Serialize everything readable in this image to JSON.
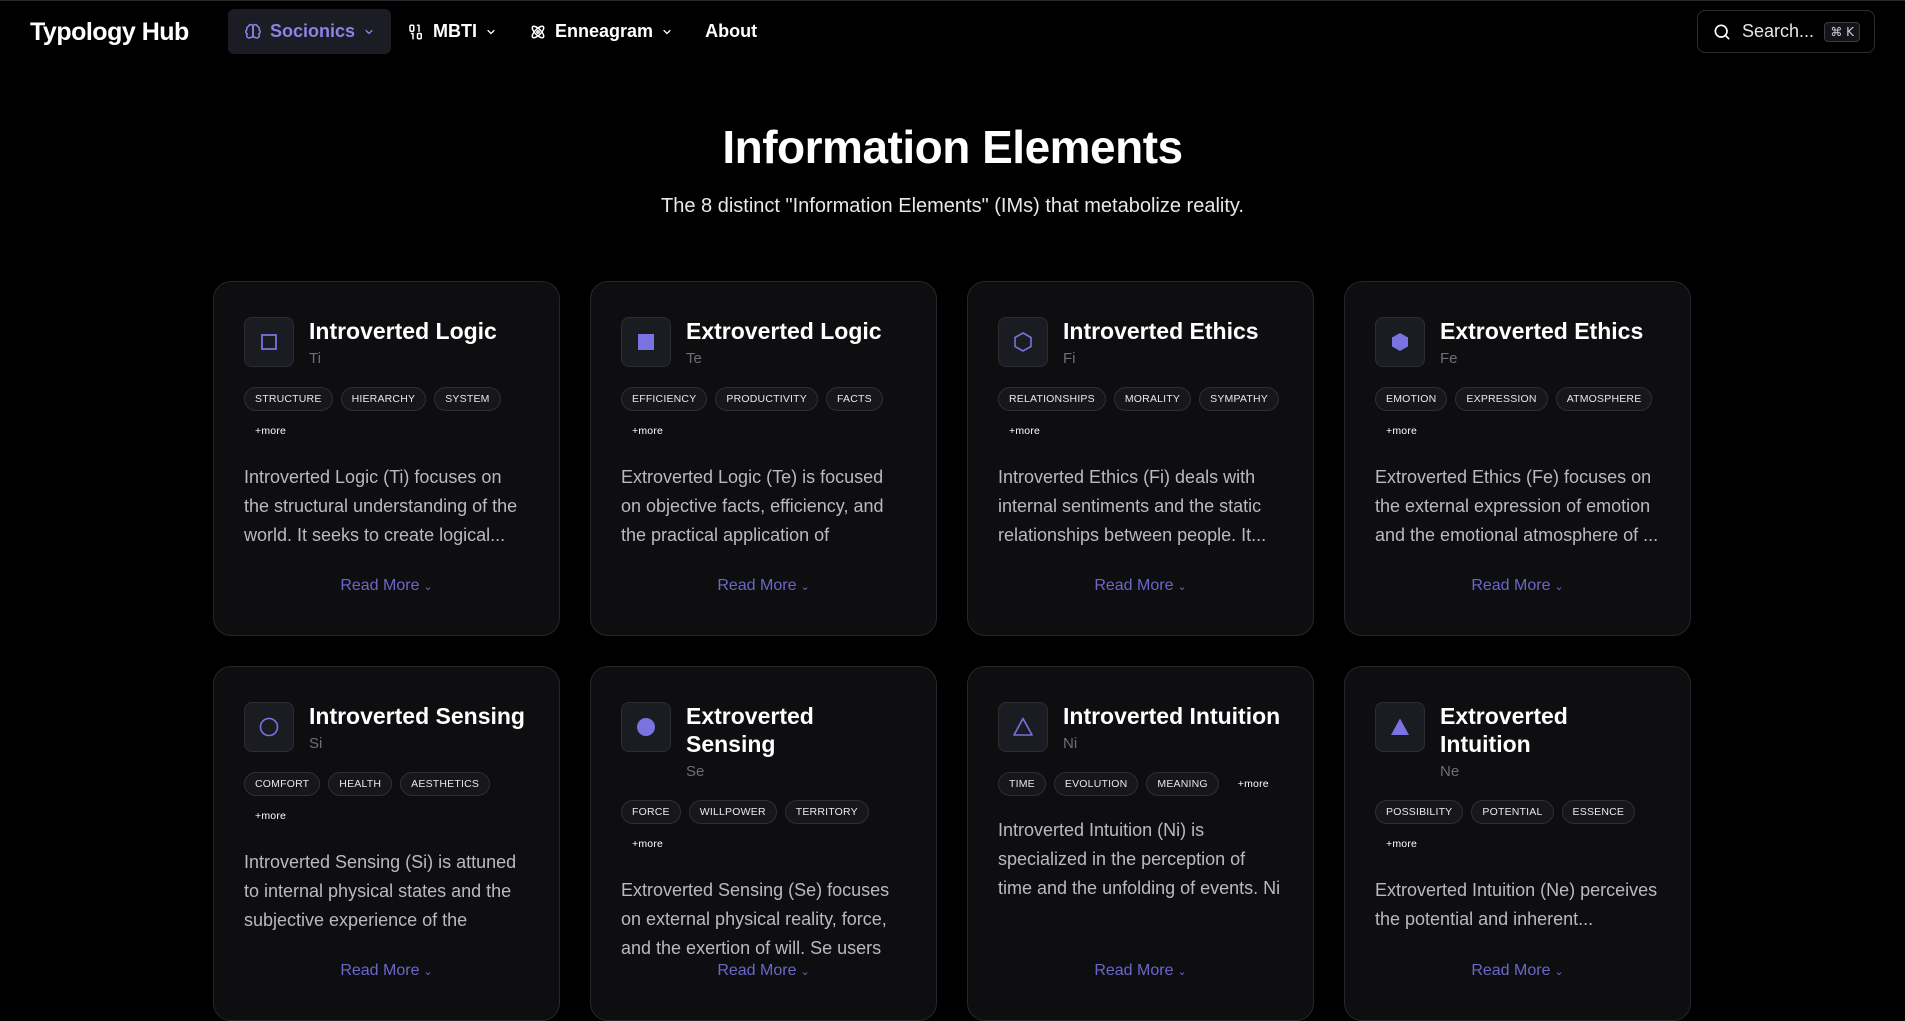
{
  "brand": "Typology Hub",
  "nav": [
    {
      "label": "Socionics",
      "icon": "brain-icon",
      "dropdown": true,
      "active": true
    },
    {
      "label": "MBTI",
      "icon": "binary-icon",
      "dropdown": true,
      "active": false
    },
    {
      "label": "Enneagram",
      "icon": "atom-icon",
      "dropdown": true,
      "active": false
    },
    {
      "label": "About",
      "icon": "",
      "dropdown": false,
      "active": false
    }
  ],
  "search": {
    "placeholder": "Search...",
    "shortcut": "⌘ K"
  },
  "hero": {
    "title": "Information Elements",
    "subtitle": "The 8 distinct \"Information Elements\" (IMs) that metabolize reality."
  },
  "colors": {
    "accent": "#6d66c9",
    "icon_fill": "#7a72e0"
  },
  "cards": [
    {
      "title": "Introverted Logic",
      "abbr": "Ti",
      "icon": "square-outline-icon",
      "tags": [
        "STRUCTURE",
        "HIERARCHY",
        "SYSTEM"
      ],
      "more": "+more",
      "description": "Introverted Logic (Ti) focuses on the structural understanding of the world. It seeks to create logical...",
      "read_more": "Read More"
    },
    {
      "title": "Extroverted Logic",
      "abbr": "Te",
      "icon": "square-filled-icon",
      "tags": [
        "EFFICIENCY",
        "PRODUCTIVITY",
        "FACTS"
      ],
      "more": "+more",
      "description": "Extroverted Logic (Te) is focused on objective facts, efficiency, and the practical application of knowledge....",
      "read_more": "Read More"
    },
    {
      "title": "Introverted Ethics",
      "abbr": "Fi",
      "icon": "hexagon-outline-icon",
      "tags": [
        "RELATIONSHIPS",
        "MORALITY",
        "SYMPATHY"
      ],
      "more": "+more",
      "description": "Introverted Ethics (Fi) deals with internal sentiments and the static relationships between people. It...",
      "read_more": "Read More"
    },
    {
      "title": "Extroverted Ethics",
      "abbr": "Fe",
      "icon": "hexagon-filled-icon",
      "tags": [
        "EMOTION",
        "EXPRESSION",
        "ATMOSPHERE"
      ],
      "more": "+more",
      "description": "Extroverted Ethics (Fe) focuses on the external expression of emotion and the emotional atmosphere of ...",
      "read_more": "Read More"
    },
    {
      "title": "Introverted Sensing",
      "abbr": "Si",
      "icon": "circle-outline-icon",
      "tags": [
        "COMFORT",
        "HEALTH",
        "AESTHETICS"
      ],
      "more": "+more",
      "description": "Introverted Sensing (Si) is attuned to internal physical states and the subjective experience of the sensor...",
      "read_more": "Read More"
    },
    {
      "title": "Extroverted Sensing",
      "abbr": "Se",
      "icon": "circle-filled-icon",
      "tags": [
        "FORCE",
        "WILLPOWER",
        "TERRITORY"
      ],
      "more": "+more",
      "description": "Extroverted Sensing (Se) focuses on external physical reality, force, and the exertion of will. Se users differ...",
      "read_more": "Read More"
    },
    {
      "title": "Introverted Intuition",
      "abbr": "Ni",
      "icon": "triangle-outline-icon",
      "tags": [
        "TIME",
        "EVOLUTION",
        "MEANING"
      ],
      "more": "+more",
      "description": "Introverted Intuition (Ni) is specialized in the perception of time and the unfolding of events. Ni use...",
      "read_more": "Read More"
    },
    {
      "title": "Extroverted Intuition",
      "abbr": "Ne",
      "icon": "triangle-filled-icon",
      "tags": [
        "POSSIBILITY",
        "POTENTIAL",
        "ESSENCE"
      ],
      "more": "+more",
      "description": "Extroverted Intuition (Ne) perceives the potential and inherent...",
      "read_more": "Read More"
    }
  ]
}
